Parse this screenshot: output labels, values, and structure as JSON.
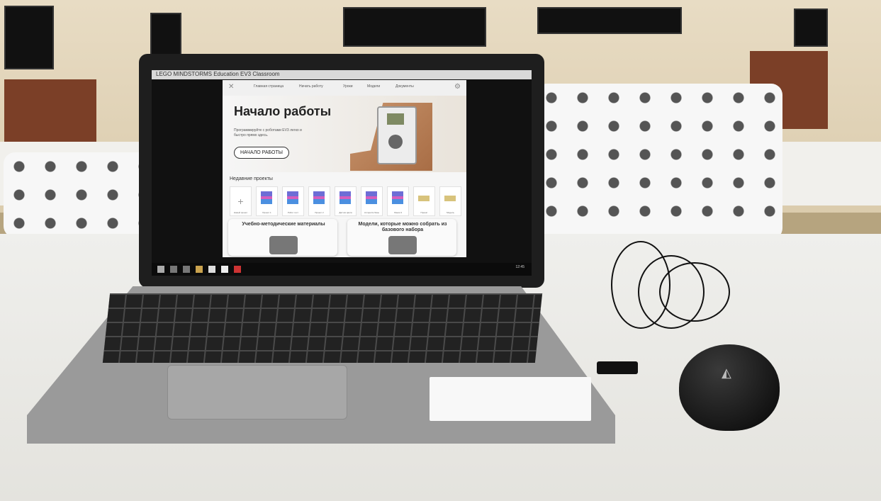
{
  "app": {
    "window_title": "LEGO MINDSTORMS Education EV3 Classroom",
    "nav": {
      "items": [
        "Главная страница",
        "Начать работу",
        "Уроки",
        "Модели",
        "Документы"
      ]
    },
    "hero": {
      "title": "Начало работы",
      "subtitle": "Программируйте с роботами EV3 легко и быстро прямо здесь.",
      "button_label": "НАЧАЛО РАБОТЫ"
    },
    "recent": {
      "title": "Недавние проекты",
      "items": [
        {
          "label": "Новый проект"
        },
        {
          "label": "Проект 1"
        },
        {
          "label": "Робот тест"
        },
        {
          "label": "Проект 2"
        },
        {
          "label": "Датчик цвета"
        },
        {
          "label": "Алгоритм базы"
        },
        {
          "label": "Линия 3"
        },
        {
          "label": "Проект"
        },
        {
          "label": "Модель"
        }
      ]
    },
    "cards": [
      {
        "title": "Учебно-методические материалы"
      },
      {
        "title": "Модели, которые можно собрать из базового набора"
      }
    ],
    "taskbar": {
      "clock": "12:45"
    }
  }
}
